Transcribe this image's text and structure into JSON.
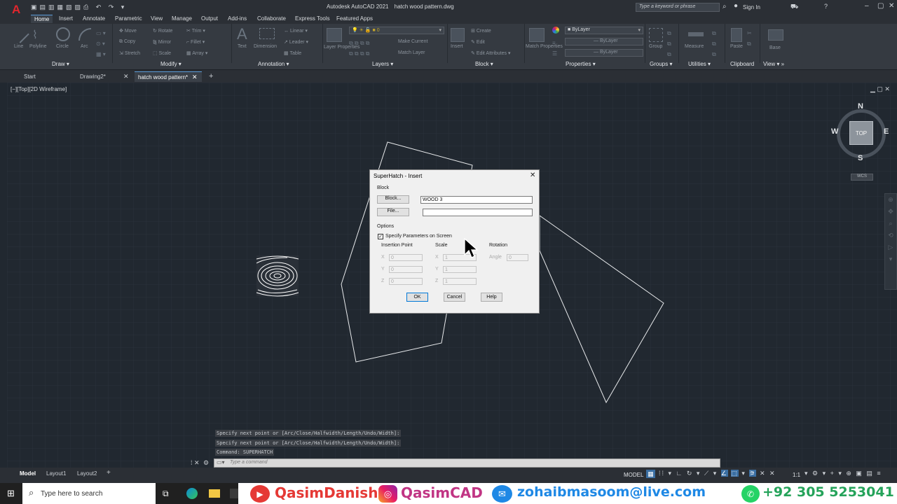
{
  "app": {
    "title": "Autodesk AutoCAD 2021",
    "file_name": "hatch wood pattern.dwg",
    "search_placeholder": "Type a keyword or phrase",
    "sign_in": "Sign In"
  },
  "menu_tabs": [
    "Home",
    "Insert",
    "Annotate",
    "Parametric",
    "View",
    "Manage",
    "Output",
    "Add-ins",
    "Collaborate",
    "Express Tools",
    "Featured Apps"
  ],
  "ribbon": {
    "draw": {
      "label": "Draw",
      "tools": [
        "Line",
        "Polyline",
        "Circle",
        "Arc"
      ]
    },
    "modify": {
      "label": "Modify",
      "tools": [
        "Move",
        "Rotate",
        "Trim",
        "Copy",
        "Mirror",
        "Fillet",
        "Stretch",
        "Scale",
        "Array"
      ]
    },
    "annotation": {
      "label": "Annotation",
      "tools": [
        "Text",
        "Dimension",
        "Linear",
        "Leader",
        "Table"
      ]
    },
    "layers": {
      "label": "Layers",
      "tools": [
        "Layer Properties",
        "Make Current",
        "Match Layer"
      ]
    },
    "block": {
      "label": "Block",
      "tools": [
        "Insert",
        "Create",
        "Edit",
        "Edit Attributes"
      ]
    },
    "properties": {
      "label": "Properties",
      "tools": [
        "Match Properties",
        "ByLayer",
        "ByLayer",
        "ByLayer"
      ]
    },
    "groups": {
      "label": "Groups",
      "tools": [
        "Group"
      ]
    },
    "utilities": {
      "label": "Utilities",
      "tools": [
        "Measure"
      ]
    },
    "clipboard": {
      "label": "Clipboard",
      "tools": [
        "Paste"
      ]
    },
    "view": {
      "label": "View",
      "tools": [
        "Base"
      ]
    }
  },
  "doc_tabs": [
    "Start",
    "Drawing2*",
    "hatch wood pattern*"
  ],
  "viewport_label": "[−][Top][2D Wireframe]",
  "viewcube": {
    "top": "TOP",
    "n": "N",
    "s": "S",
    "e": "E",
    "w": "W",
    "wcs": "WCS"
  },
  "dialog": {
    "title": "SuperHatch - Insert",
    "block_section": "Block",
    "block_button": "Block...",
    "block_value": "WOOD 3",
    "file_button": "File...",
    "file_value": "",
    "options_section": "Options",
    "specify_checkbox": "Specify Parameters on Screen",
    "specify_checked": true,
    "insertion_point": "Insertion Point",
    "scale": "Scale",
    "rotation": "Rotation",
    "ip_x_label": "X",
    "ip_y_label": "Y",
    "ip_z_label": "Z",
    "ip_x": "0",
    "ip_y": "0",
    "ip_z": "0",
    "sc_x_label": "X",
    "sc_y_label": "Y",
    "sc_z_label": "Z",
    "sc_x": "1",
    "sc_y": "1",
    "sc_z": "1",
    "angle_label": "Angle",
    "angle": "0",
    "ok": "OK",
    "cancel": "Cancel",
    "help": "Help"
  },
  "command_history": [
    "Specify next point or [Arc/Close/Halfwidth/Length/Undo/Width]:",
    "Specify next point or [Arc/Close/Halfwidth/Length/Undo/Width]:",
    "Command: SUPERHATCH"
  ],
  "command_placeholder": "Type a command",
  "layout_tabs": [
    "Model",
    "Layout1",
    "Layout2"
  ],
  "status": {
    "model": "MODEL",
    "scale": "1:1"
  },
  "taskbar": {
    "search_placeholder": "Type here to search"
  },
  "social": {
    "youtube": "QasimDanish",
    "instagram": "QasimCAD",
    "email": "zohaibmasoom@live.com",
    "phone": "+92 305 5253041"
  },
  "colors": {
    "accent": "#5a9bd8",
    "canvas": "#212830",
    "youtube": "#e53935",
    "instagram": "#c13584",
    "email": "#1e88e5",
    "whatsapp": "#25d366"
  }
}
